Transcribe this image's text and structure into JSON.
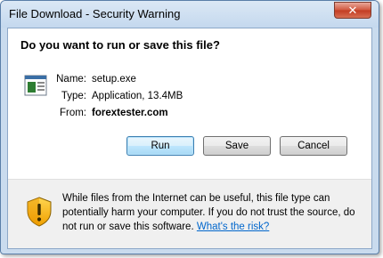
{
  "window": {
    "title": "File Download - Security Warning",
    "close_glyph": "✕"
  },
  "dialog": {
    "question": "Do you want to run or save this file?",
    "file": {
      "icon": "application-file-icon",
      "name_label": "Name:",
      "name_value": "setup.exe",
      "type_label": "Type:",
      "type_value": "Application, 13.4MB",
      "from_label": "From:",
      "from_value": "forextester.com"
    },
    "buttons": {
      "run": "Run",
      "save": "Save",
      "cancel": "Cancel"
    },
    "warning": {
      "icon": "security-shield-warning-icon",
      "text": "While files from the Internet can be useful, this file type can potentially harm your computer. If you do not trust the source, do not run or save this software. ",
      "link": "What's the risk?"
    }
  },
  "colors": {
    "frame": "#c9dbee",
    "link": "#0066cc",
    "focused_button": "#3c7fb1",
    "close_button": "#c23b22"
  }
}
